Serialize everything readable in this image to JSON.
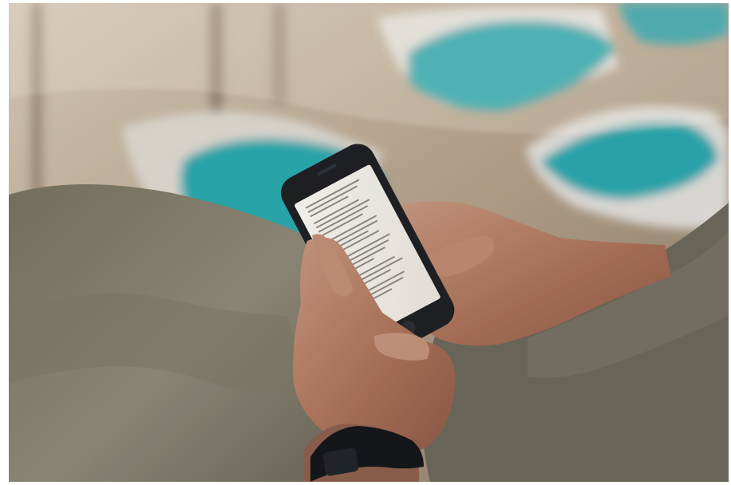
{
  "image": {
    "kind": "photograph",
    "colors": {
      "background_floor": "#b7a58f",
      "teal_objects": "#1fa6ad",
      "trousers": "#8c8777",
      "skin": "#b07a62",
      "phone_body": "#1f2124",
      "screen": "#f3f0eb",
      "watch": "#15171a"
    }
  }
}
